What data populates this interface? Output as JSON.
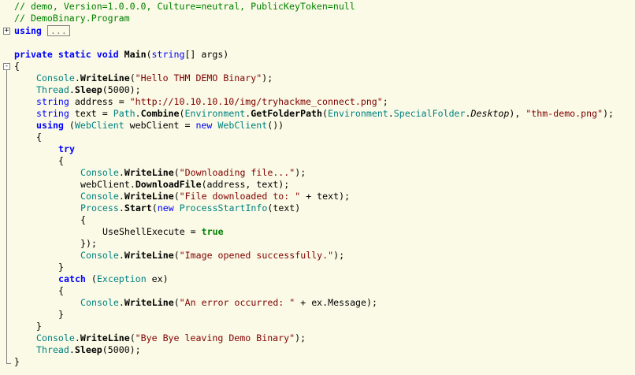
{
  "code": {
    "header_comment_1": "// demo, Version=1.0.0.0, Culture=neutral, PublicKeyToken=null",
    "header_comment_2": "// DemoBinary.Program",
    "using_keyword": "using",
    "using_collapsed": "...",
    "lines": [
      {
        "indent": 0,
        "tokens": [
          [
            "kw",
            "private"
          ],
          [
            "t",
            " "
          ],
          [
            "kw",
            "static"
          ],
          [
            "t",
            " "
          ],
          [
            "kw",
            "void"
          ],
          [
            "t",
            " "
          ],
          [
            "mb",
            "Main"
          ],
          [
            "t",
            "("
          ],
          [
            "kwn",
            "string"
          ],
          [
            "t",
            "[] args)"
          ]
        ]
      },
      {
        "indent": 0,
        "tokens": [
          [
            "t",
            "{"
          ]
        ]
      },
      {
        "indent": 1,
        "tokens": [
          [
            "typ",
            "Console"
          ],
          [
            "t",
            "."
          ],
          [
            "mb",
            "WriteLine"
          ],
          [
            "t",
            "("
          ],
          [
            "str",
            "\"Hello THM DEMO Binary\""
          ],
          [
            "t",
            ");"
          ]
        ]
      },
      {
        "indent": 1,
        "tokens": [
          [
            "typ",
            "Thread"
          ],
          [
            "t",
            "."
          ],
          [
            "mb",
            "Sleep"
          ],
          [
            "t",
            "(5000);"
          ]
        ]
      },
      {
        "indent": 1,
        "tokens": [
          [
            "kwn",
            "string"
          ],
          [
            "t",
            " address = "
          ],
          [
            "str",
            "\"http://10.10.10.10/img/tryhackme_connect.png\""
          ],
          [
            "t",
            ";"
          ]
        ]
      },
      {
        "indent": 1,
        "tokens": [
          [
            "kwn",
            "string"
          ],
          [
            "t",
            " text = "
          ],
          [
            "typ",
            "Path"
          ],
          [
            "t",
            "."
          ],
          [
            "mb",
            "Combine"
          ],
          [
            "t",
            "("
          ],
          [
            "typ",
            "Environment"
          ],
          [
            "t",
            "."
          ],
          [
            "mb",
            "GetFolderPath"
          ],
          [
            "t",
            "("
          ],
          [
            "typ",
            "Environment"
          ],
          [
            "t",
            "."
          ],
          [
            "typ",
            "SpecialFolder"
          ],
          [
            "t",
            "."
          ],
          [
            "em",
            "Desktop"
          ],
          [
            "t",
            "), "
          ],
          [
            "str",
            "\"thm-demo.png\""
          ],
          [
            "t",
            ");"
          ]
        ]
      },
      {
        "indent": 1,
        "tokens": [
          [
            "kw",
            "using"
          ],
          [
            "t",
            " ("
          ],
          [
            "typ",
            "WebClient"
          ],
          [
            "t",
            " webClient = "
          ],
          [
            "kwn",
            "new"
          ],
          [
            "t",
            " "
          ],
          [
            "typ",
            "WebClient"
          ],
          [
            "t",
            "())"
          ]
        ]
      },
      {
        "indent": 1,
        "tokens": [
          [
            "t",
            "{"
          ]
        ]
      },
      {
        "indent": 2,
        "tokens": [
          [
            "kw",
            "try"
          ]
        ]
      },
      {
        "indent": 2,
        "tokens": [
          [
            "t",
            "{"
          ]
        ]
      },
      {
        "indent": 3,
        "tokens": [
          [
            "typ",
            "Console"
          ],
          [
            "t",
            "."
          ],
          [
            "mb",
            "WriteLine"
          ],
          [
            "t",
            "("
          ],
          [
            "str",
            "\"Downloading file...\""
          ],
          [
            "t",
            ");"
          ]
        ]
      },
      {
        "indent": 3,
        "tokens": [
          [
            "t",
            "webClient."
          ],
          [
            "mb",
            "DownloadFile"
          ],
          [
            "t",
            "(address, text);"
          ]
        ]
      },
      {
        "indent": 3,
        "tokens": [
          [
            "typ",
            "Console"
          ],
          [
            "t",
            "."
          ],
          [
            "mb",
            "WriteLine"
          ],
          [
            "t",
            "("
          ],
          [
            "str",
            "\"File downloaded to: \""
          ],
          [
            "t",
            " + text);"
          ]
        ]
      },
      {
        "indent": 3,
        "tokens": [
          [
            "typ",
            "Process"
          ],
          [
            "t",
            "."
          ],
          [
            "mb",
            "Start"
          ],
          [
            "t",
            "("
          ],
          [
            "kwn",
            "new"
          ],
          [
            "t",
            " "
          ],
          [
            "typ",
            "ProcessStartInfo"
          ],
          [
            "t",
            "(text)"
          ]
        ]
      },
      {
        "indent": 3,
        "tokens": [
          [
            "t",
            "{"
          ]
        ]
      },
      {
        "indent": 4,
        "tokens": [
          [
            "t",
            "UseShellExecute = "
          ],
          [
            "lit",
            "true"
          ]
        ]
      },
      {
        "indent": 3,
        "tokens": [
          [
            "t",
            "});"
          ]
        ]
      },
      {
        "indent": 3,
        "tokens": [
          [
            "typ",
            "Console"
          ],
          [
            "t",
            "."
          ],
          [
            "mb",
            "WriteLine"
          ],
          [
            "t",
            "("
          ],
          [
            "str",
            "\"Image opened successfully.\""
          ],
          [
            "t",
            ");"
          ]
        ]
      },
      {
        "indent": 2,
        "tokens": [
          [
            "t",
            "}"
          ]
        ]
      },
      {
        "indent": 2,
        "tokens": [
          [
            "kw",
            "catch"
          ],
          [
            "t",
            " ("
          ],
          [
            "typ",
            "Exception"
          ],
          [
            "t",
            " ex)"
          ]
        ]
      },
      {
        "indent": 2,
        "tokens": [
          [
            "t",
            "{"
          ]
        ]
      },
      {
        "indent": 3,
        "tokens": [
          [
            "typ",
            "Console"
          ],
          [
            "t",
            "."
          ],
          [
            "mb",
            "WriteLine"
          ],
          [
            "t",
            "("
          ],
          [
            "str",
            "\"An error occurred: \""
          ],
          [
            "t",
            " + ex.Message);"
          ]
        ]
      },
      {
        "indent": 2,
        "tokens": [
          [
            "t",
            "}"
          ]
        ]
      },
      {
        "indent": 1,
        "tokens": [
          [
            "t",
            "}"
          ]
        ]
      },
      {
        "indent": 1,
        "tokens": [
          [
            "typ",
            "Console"
          ],
          [
            "t",
            "."
          ],
          [
            "mb",
            "WriteLine"
          ],
          [
            "t",
            "("
          ],
          [
            "str",
            "\"Bye Bye leaving Demo Binary\""
          ],
          [
            "t",
            ");"
          ]
        ]
      },
      {
        "indent": 1,
        "tokens": [
          [
            "typ",
            "Thread"
          ],
          [
            "t",
            "."
          ],
          [
            "mb",
            "Sleep"
          ],
          [
            "t",
            "(5000);"
          ]
        ]
      },
      {
        "indent": 0,
        "tokens": [
          [
            "t",
            "}"
          ]
        ]
      }
    ]
  },
  "fold": {
    "expand_symbol": "+",
    "collapse_symbol": "-"
  }
}
